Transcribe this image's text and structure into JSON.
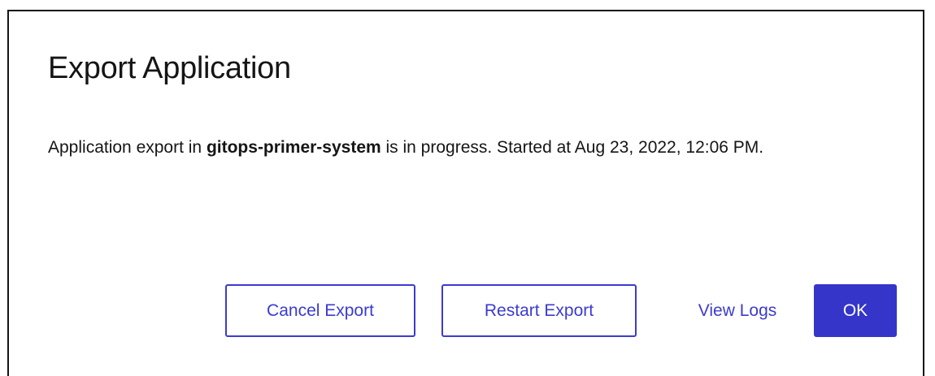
{
  "modal": {
    "title": "Export Application",
    "body": {
      "prefix": "Application export in ",
      "namespace": "gitops-primer-system",
      "suffix": " is in progress. Started at Aug 23, 2022, 12:06 PM."
    },
    "buttons": {
      "cancel": "Cancel Export",
      "restart": "Restart Export",
      "view_logs": "View Logs",
      "ok": "OK"
    }
  },
  "colors": {
    "accent": "#3535c9",
    "text": "#151515",
    "border": "#151515"
  }
}
